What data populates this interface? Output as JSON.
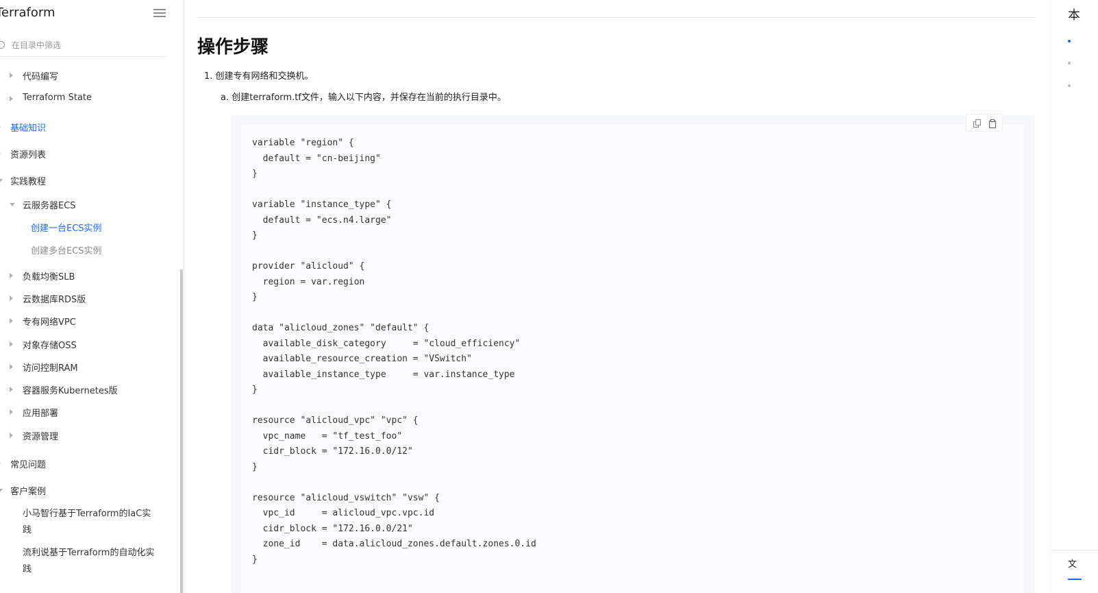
{
  "sidebar": {
    "title": "Terraform",
    "search_placeholder": "在目录中筛选",
    "items": [
      {
        "label": "代码编写"
      },
      {
        "label": "Terraform State"
      },
      {
        "label": "基础知识"
      },
      {
        "label": "资源列表"
      },
      {
        "label": "实践教程"
      },
      {
        "label": "云服务器ECS"
      },
      {
        "label": "创建一台ECS实例"
      },
      {
        "label": "创建多台ECS实例"
      },
      {
        "label": "负载均衡SLB"
      },
      {
        "label": "云数据库RDS版"
      },
      {
        "label": "专有网络VPC"
      },
      {
        "label": "对象存储OSS"
      },
      {
        "label": "访问控制RAM"
      },
      {
        "label": "容器服务Kubernetes版"
      },
      {
        "label": "应用部署"
      },
      {
        "label": "资源管理"
      },
      {
        "label": "常见问题"
      },
      {
        "label": "客户案例"
      },
      {
        "label": "小马智行基于Terraform的IaC实践"
      },
      {
        "label": "流利说基于Terraform的自动化实践"
      }
    ]
  },
  "main": {
    "heading": "操作步骤",
    "step1": "1. 创建专有网络和交换机。",
    "step1a": "a. 创建terraform.tf文件，输入以下内容，并保存在当前的执行目录中。",
    "code": "variable \"region\" {\n  default = \"cn-beijing\"\n}\n\nvariable \"instance_type\" {\n  default = \"ecs.n4.large\"\n}\n\nprovider \"alicloud\" {\n  region = var.region\n}\n\ndata \"alicloud_zones\" \"default\" {\n  available_disk_category     = \"cloud_efficiency\"\n  available_resource_creation = \"VSwitch\"\n  available_instance_type     = var.instance_type\n}\n\nresource \"alicloud_vpc\" \"vpc\" {\n  vpc_name   = \"tf_test_foo\"\n  cidr_block = \"172.16.0.0/12\"\n}\n\nresource \"alicloud_vswitch\" \"vsw\" {\n  vpc_id     = alicloud_vpc.vpc.id\n  cidr_block = \"172.16.0.0/21\"\n  zone_id    = data.alicloud_zones.default.zones.0.id\n}"
  },
  "right_rail": {
    "title": "本",
    "bottom_label": "文"
  },
  "colors": {
    "accent": "#1a66ff",
    "code_bg": "#f5f7fa"
  }
}
